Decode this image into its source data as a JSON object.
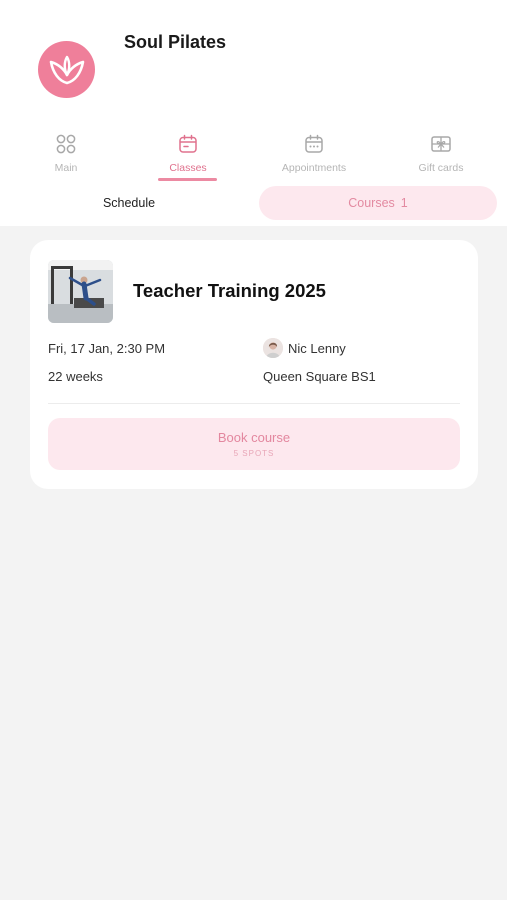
{
  "header": {
    "brand": "Soul Pilates",
    "logo_color": "#ef7f9a"
  },
  "tabs": [
    {
      "label": "Main",
      "icon": "grid-icon",
      "active": false
    },
    {
      "label": "Classes",
      "icon": "calendar-icon",
      "active": true
    },
    {
      "label": "Appointments",
      "icon": "calendar-dots-icon",
      "active": false
    },
    {
      "label": "Gift cards",
      "icon": "gift-card-icon",
      "active": false
    }
  ],
  "segments": {
    "schedule": "Schedule",
    "courses": "Courses",
    "courses_count": "1"
  },
  "course": {
    "title": "Teacher Training 2025",
    "date": "Fri, 17 Jan, 2:30 PM",
    "duration": "22 weeks",
    "teacher": "Nic Lenny",
    "location": "Queen Square BS1",
    "book_label": "Book course",
    "spots": "5 SPOTS"
  },
  "colors": {
    "accent": "#e0728e",
    "accent_light": "#fde8ee",
    "background": "#f3f3f3"
  }
}
